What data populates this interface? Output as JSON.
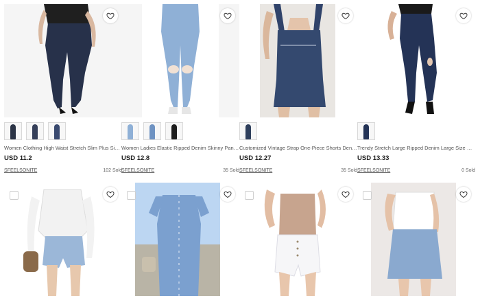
{
  "products": [
    {
      "title": "Women Clothing High Waist Stretch Slim Plus Size Jeans",
      "price": "USD 11.2",
      "seller": "SFEELSONITE",
      "sold": "102 Sold",
      "thumb_colors": [
        "#2b3446",
        "#36405a",
        "#3a4a70"
      ]
    },
    {
      "title": "Women Ladies Elastic Ripped Denim Skinny Pants Jeans",
      "price": "USD 12.8",
      "seller": "SFEELSONITE",
      "sold": "35 Sold",
      "thumb_colors": [
        "#8fb0d6",
        "#6f93c2",
        "#1d1d1d"
      ]
    },
    {
      "title": "Customized Vintage Strap One-Piece Shorts Denim Overalls",
      "price": "USD 12.27",
      "seller": "SFEELSONITE",
      "sold": "35 Sold",
      "thumb_colors": [
        "#2e3f5c"
      ]
    },
    {
      "title": "Trendy Stretch Large Ripped Denim Large Size Slim Jeans",
      "price": "USD 13.33",
      "seller": "SFEELSONITE",
      "sold": "0 Sold",
      "thumb_colors": [
        "#243356"
      ]
    },
    {
      "title": "",
      "price": "",
      "seller": "",
      "sold": "",
      "thumb_colors": []
    },
    {
      "title": "",
      "price": "",
      "seller": "",
      "sold": "",
      "thumb_colors": []
    },
    {
      "title": "",
      "price": "",
      "seller": "",
      "sold": "",
      "thumb_colors": []
    },
    {
      "title": "",
      "price": "",
      "seller": "",
      "sold": "",
      "thumb_colors": []
    }
  ],
  "colors": {
    "denim_dark": "#27314a",
    "denim_light": "#8fb0d6",
    "heart_stroke": "#333333"
  },
  "icons": {
    "favorite": "heart-icon",
    "select": "checkbox"
  }
}
